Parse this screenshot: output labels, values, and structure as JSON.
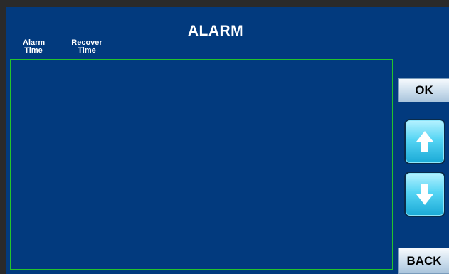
{
  "header": {
    "title": "ALARM"
  },
  "columns": {
    "alarm_time": [
      "Alarm",
      "Time"
    ],
    "recover_time": [
      "Recover",
      "Time"
    ]
  },
  "alarm_list": {
    "rows": []
  },
  "buttons": {
    "ok_label": "OK",
    "back_label": "BACK",
    "scroll_up_icon": "arrow-up-icon",
    "scroll_down_icon": "arrow-down-icon"
  },
  "colors": {
    "background": "#023a7e",
    "list_border": "#24c42a",
    "arrow_button": "#56d5f4"
  }
}
